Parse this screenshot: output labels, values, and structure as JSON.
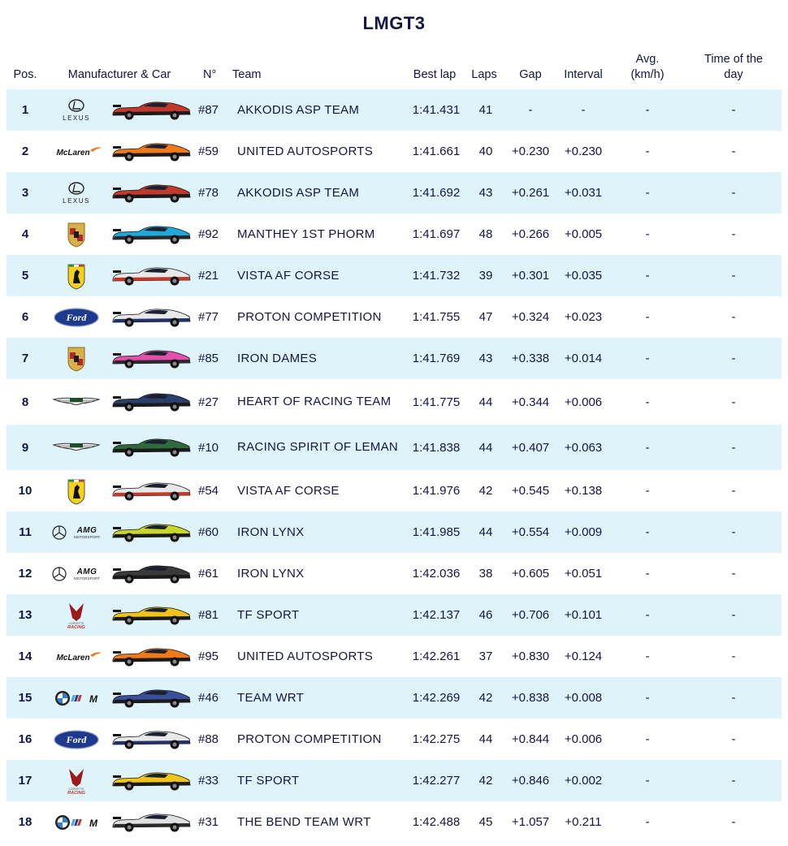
{
  "title": "LMGT3",
  "headers": {
    "pos": "Pos.",
    "manufacturer": "Manufacturer & Car",
    "number": "N°",
    "team": "Team",
    "best_lap": "Best lap",
    "laps": "Laps",
    "gap": "Gap",
    "interval": "Interval",
    "avg_line1": "Avg.",
    "avg_line2": "(km/h)",
    "tod_line1": "Time of the",
    "tod_line2": "day"
  },
  "brand_text": {
    "lexus": "LEXUS",
    "mclaren": "McLaren",
    "ford": "Ford",
    "amg": "AMG",
    "amg_sub": "MOTORSPORT",
    "racing": "RACING",
    "corvette": "CORVETTE",
    "bmw_m": "M"
  },
  "rows": [
    {
      "pos": "1",
      "brand": "lexus-logo-icon",
      "car_colors": [
        "#c0392b",
        "#1b1b1b"
      ],
      "number": "#87",
      "team": "AKKODIS ASP TEAM",
      "best_lap": "1:41.431",
      "laps": "41",
      "gap": "-",
      "interval": "-",
      "avg": "-",
      "tod": "-"
    },
    {
      "pos": "2",
      "brand": "mclaren-logo-icon",
      "car_colors": [
        "#f07a1a",
        "#1b1b1b"
      ],
      "number": "#59",
      "team": "UNITED AUTOSPORTS",
      "best_lap": "1:41.661",
      "laps": "40",
      "gap": "+0.230",
      "interval": "+0.230",
      "avg": "-",
      "tod": "-"
    },
    {
      "pos": "3",
      "brand": "lexus-logo-icon",
      "car_colors": [
        "#c0392b",
        "#1b1b1b"
      ],
      "number": "#78",
      "team": "AKKODIS ASP TEAM",
      "best_lap": "1:41.692",
      "laps": "43",
      "gap": "+0.261",
      "interval": "+0.031",
      "avg": "-",
      "tod": "-"
    },
    {
      "pos": "4",
      "brand": "porsche-logo-icon",
      "car_colors": [
        "#1fa9d8",
        "#2a2a2a"
      ],
      "number": "#92",
      "team": "MANTHEY 1ST PHORM",
      "best_lap": "1:41.697",
      "laps": "48",
      "gap": "+0.266",
      "interval": "+0.005",
      "avg": "-",
      "tod": "-"
    },
    {
      "pos": "5",
      "brand": "ferrari-logo-icon",
      "car_colors": [
        "#e8e8e8",
        "#c0392b"
      ],
      "number": "#21",
      "team": "VISTA AF CORSE",
      "best_lap": "1:41.732",
      "laps": "39",
      "gap": "+0.301",
      "interval": "+0.035",
      "avg": "-",
      "tod": "-"
    },
    {
      "pos": "6",
      "brand": "ford-logo-icon",
      "car_colors": [
        "#e8e8e8",
        "#23306b"
      ],
      "number": "#77",
      "team": "PROTON COMPETITION",
      "best_lap": "1:41.755",
      "laps": "47",
      "gap": "+0.324",
      "interval": "+0.023",
      "avg": "-",
      "tod": "-"
    },
    {
      "pos": "7",
      "brand": "porsche-logo-icon",
      "car_colors": [
        "#e44fae",
        "#2a2a2a"
      ],
      "number": "#85",
      "team": "IRON DAMES",
      "best_lap": "1:41.769",
      "laps": "43",
      "gap": "+0.338",
      "interval": "+0.014",
      "avg": "-",
      "tod": "-"
    },
    {
      "pos": "8",
      "brand": "aston-martin-logo-icon",
      "car_colors": [
        "#2b3f6b",
        "#1b1b1b"
      ],
      "number": "#27",
      "team": "HEART OF RACING TEAM",
      "best_lap": "1:41.775",
      "laps": "44",
      "gap": "+0.344",
      "interval": "+0.006",
      "avg": "-",
      "tod": "-",
      "tall": true
    },
    {
      "pos": "9",
      "brand": "aston-martin-logo-icon",
      "car_colors": [
        "#2f6a3a",
        "#1b1b1b"
      ],
      "number": "#10",
      "team": "RACING SPIRIT OF LEMAN",
      "best_lap": "1:41.838",
      "laps": "44",
      "gap": "+0.407",
      "interval": "+0.063",
      "avg": "-",
      "tod": "-",
      "tall": true
    },
    {
      "pos": "10",
      "brand": "ferrari-logo-icon",
      "car_colors": [
        "#e8e8e8",
        "#c0392b"
      ],
      "number": "#54",
      "team": "VISTA AF CORSE",
      "best_lap": "1:41.976",
      "laps": "42",
      "gap": "+0.545",
      "interval": "+0.138",
      "avg": "-",
      "tod": "-"
    },
    {
      "pos": "11",
      "brand": "mercedes-amg-logo-icon",
      "car_colors": [
        "#c8d82a",
        "#1b1b1b"
      ],
      "number": "#60",
      "team": "IRON LYNX",
      "best_lap": "1:41.985",
      "laps": "44",
      "gap": "+0.554",
      "interval": "+0.009",
      "avg": "-",
      "tod": "-"
    },
    {
      "pos": "12",
      "brand": "mercedes-amg-logo-icon",
      "car_colors": [
        "#3a3a3a",
        "#1b1b1b"
      ],
      "number": "#61",
      "team": "IRON LYNX",
      "best_lap": "1:42.036",
      "laps": "38",
      "gap": "+0.605",
      "interval": "+0.051",
      "avg": "-",
      "tod": "-"
    },
    {
      "pos": "13",
      "brand": "corvette-logo-icon",
      "car_colors": [
        "#f0c419",
        "#1b1b1b"
      ],
      "number": "#81",
      "team": "TF SPORT",
      "best_lap": "1:42.137",
      "laps": "46",
      "gap": "+0.706",
      "interval": "+0.101",
      "avg": "-",
      "tod": "-"
    },
    {
      "pos": "14",
      "brand": "mclaren-logo-icon",
      "car_colors": [
        "#f07a1a",
        "#1b1b1b"
      ],
      "number": "#95",
      "team": "UNITED AUTOSPORTS",
      "best_lap": "1:42.261",
      "laps": "37",
      "gap": "+0.830",
      "interval": "+0.124",
      "avg": "-",
      "tod": "-"
    },
    {
      "pos": "15",
      "brand": "bmw-m-logo-icon",
      "car_colors": [
        "#3a4f9c",
        "#1b1b1b"
      ],
      "number": "#46",
      "team": "TEAM WRT",
      "best_lap": "1:42.269",
      "laps": "42",
      "gap": "+0.838",
      "interval": "+0.008",
      "avg": "-",
      "tod": "-"
    },
    {
      "pos": "16",
      "brand": "ford-logo-icon",
      "car_colors": [
        "#e8e8e8",
        "#23306b"
      ],
      "number": "#88",
      "team": "PROTON COMPETITION",
      "best_lap": "1:42.275",
      "laps": "44",
      "gap": "+0.844",
      "interval": "+0.006",
      "avg": "-",
      "tod": "-"
    },
    {
      "pos": "17",
      "brand": "corvette-logo-icon",
      "car_colors": [
        "#f0c419",
        "#1b1b1b"
      ],
      "number": "#33",
      "team": "TF SPORT",
      "best_lap": "1:42.277",
      "laps": "42",
      "gap": "+0.846",
      "interval": "+0.002",
      "avg": "-",
      "tod": "-"
    },
    {
      "pos": "18",
      "brand": "bmw-m-logo-icon",
      "car_colors": [
        "#e0e0e0",
        "#2a2a2a"
      ],
      "number": "#31",
      "team": "THE BEND TEAM WRT",
      "best_lap": "1:42.488",
      "laps": "45",
      "gap": "+1.057",
      "interval": "+0.211",
      "avg": "-",
      "tod": "-"
    }
  ],
  "colors": {
    "text": "#121640",
    "row_shade": "#dff3fb",
    "row_plain": "#ffffff"
  }
}
